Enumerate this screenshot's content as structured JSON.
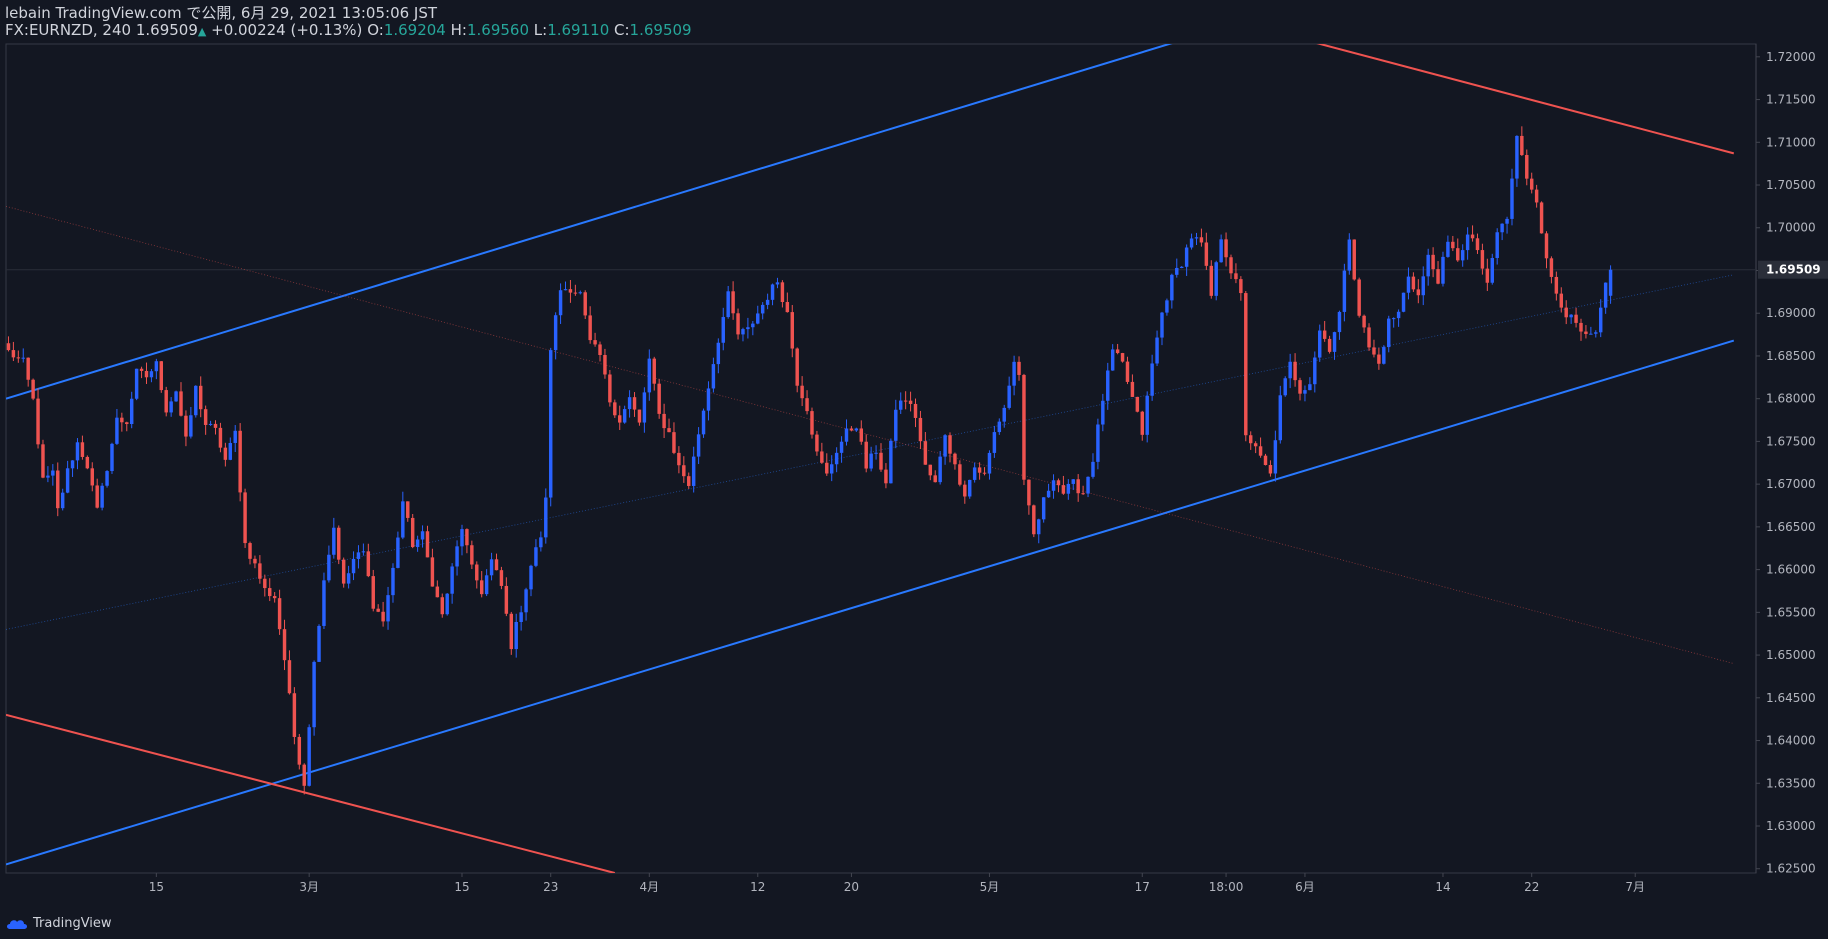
{
  "header": {
    "line1": "lebain TradingView.com で公開, 6月 29, 2021 13:05:06 JST",
    "symbol": "FX:EURNZD, 240",
    "last": "1.69509",
    "change_arrow": "▲",
    "change": "+0.00224 (+0.13%)",
    "o_label": "O:",
    "o": "1.69204",
    "h_label": "H:",
    "h": "1.69560",
    "l_label": "L:",
    "l": "1.69110",
    "c_label": "C:",
    "c": "1.69509"
  },
  "footer": {
    "brand": "TradingView",
    "icon": "tradingview-cloud-icon"
  },
  "colors": {
    "background": "#131722",
    "up": "#2962ff",
    "down": "#ef5350",
    "channel_blue": "#2979ff",
    "channel_red": "#ef5350",
    "axis_text": "#b2b5be",
    "ohlc_value": "#26a69a"
  },
  "chart_data": {
    "type": "candlestick",
    "y_ticks": [
      "1.72000",
      "1.71500",
      "1.71000",
      "1.70500",
      "1.70000",
      "1.69500",
      "1.69000",
      "1.68500",
      "1.68000",
      "1.67500",
      "1.67000",
      "1.66500",
      "1.66000",
      "1.65500",
      "1.65000",
      "1.64500",
      "1.64000",
      "1.63500",
      "1.63000",
      "1.62500"
    ],
    "ylim": [
      1.6245,
      1.7215
    ],
    "last_price_label": "1.69509",
    "x_ticks": [
      "15",
      "3月",
      "15",
      "23",
      "4月",
      "12",
      "20",
      "5月",
      "17",
      "18:00",
      "6月",
      "14",
      "22",
      "7月"
    ],
    "x_tick_index": [
      30,
      61,
      92,
      110,
      130,
      152,
      171,
      199,
      230,
      247,
      263,
      291,
      309,
      330
    ],
    "n_bars": 355,
    "close_path": [
      [
        0,
        1.6855
      ],
      [
        3,
        1.6842
      ],
      [
        5,
        1.6798
      ],
      [
        7,
        1.6703
      ],
      [
        9,
        1.6712
      ],
      [
        10,
        1.6669
      ],
      [
        12,
        1.6715
      ],
      [
        14,
        1.6748
      ],
      [
        16,
        1.6722
      ],
      [
        18,
        1.6668
      ],
      [
        20,
        1.672
      ],
      [
        22,
        1.6775
      ],
      [
        24,
        1.6773
      ],
      [
        26,
        1.683
      ],
      [
        28,
        1.6826
      ],
      [
        30,
        1.684
      ],
      [
        32,
        1.6788
      ],
      [
        34,
        1.681
      ],
      [
        36,
        1.675
      ],
      [
        38,
        1.6812
      ],
      [
        40,
        1.677
      ],
      [
        42,
        1.6762
      ],
      [
        44,
        1.6728
      ],
      [
        46,
        1.676
      ],
      [
        48,
        1.663
      ],
      [
        50,
        1.6605
      ],
      [
        52,
        1.6576
      ],
      [
        54,
        1.6568
      ],
      [
        56,
        1.6495
      ],
      [
        58,
        1.6405
      ],
      [
        60,
        1.635
      ],
      [
        62,
        1.649
      ],
      [
        64,
        1.659
      ],
      [
        66,
        1.665
      ],
      [
        68,
        1.658
      ],
      [
        70,
        1.6612
      ],
      [
        72,
        1.662
      ],
      [
        74,
        1.656
      ],
      [
        76,
        1.654
      ],
      [
        78,
        1.66
      ],
      [
        80,
        1.668
      ],
      [
        82,
        1.663
      ],
      [
        84,
        1.664
      ],
      [
        86,
        1.6586
      ],
      [
        88,
        1.6546
      ],
      [
        90,
        1.66
      ],
      [
        92,
        1.665
      ],
      [
        94,
        1.66
      ],
      [
        96,
        1.6575
      ],
      [
        98,
        1.661
      ],
      [
        100,
        1.658
      ],
      [
        102,
        1.6512
      ],
      [
        104,
        1.6555
      ],
      [
        106,
        1.6605
      ],
      [
        108,
        1.664
      ],
      [
        109,
        1.668
      ],
      [
        110,
        1.686
      ],
      [
        112,
        1.6928
      ],
      [
        114,
        1.693
      ],
      [
        116,
        1.6922
      ],
      [
        118,
        1.6865
      ],
      [
        120,
        1.685
      ],
      [
        122,
        1.6798
      ],
      [
        124,
        1.6775
      ],
      [
        126,
        1.68
      ],
      [
        128,
        1.677
      ],
      [
        130,
        1.6845
      ],
      [
        132,
        1.678
      ],
      [
        134,
        1.676
      ],
      [
        136,
        1.672
      ],
      [
        138,
        1.67
      ],
      [
        140,
        1.676
      ],
      [
        142,
        1.6815
      ],
      [
        144,
        1.687
      ],
      [
        146,
        1.692
      ],
      [
        148,
        1.6875
      ],
      [
        150,
        1.688
      ],
      [
        152,
        1.69
      ],
      [
        154,
        1.692
      ],
      [
        156,
        1.6938
      ],
      [
        158,
        1.69
      ],
      [
        160,
        1.682
      ],
      [
        162,
        1.679
      ],
      [
        164,
        1.6735
      ],
      [
        166,
        1.671
      ],
      [
        168,
        1.674
      ],
      [
        170,
        1.676
      ],
      [
        172,
        1.677
      ],
      [
        174,
        1.672
      ],
      [
        176,
        1.674
      ],
      [
        178,
        1.67
      ],
      [
        180,
        1.679
      ],
      [
        182,
        1.68
      ],
      [
        184,
        1.678
      ],
      [
        186,
        1.672
      ],
      [
        188,
        1.67
      ],
      [
        190,
        1.676
      ],
      [
        192,
        1.672
      ],
      [
        194,
        1.669
      ],
      [
        196,
        1.672
      ],
      [
        198,
        1.671
      ],
      [
        200,
        1.676
      ],
      [
        202,
        1.679
      ],
      [
        204,
        1.6842
      ],
      [
        205,
        1.683
      ],
      [
        206,
        1.67
      ],
      [
        208,
        1.664
      ],
      [
        210,
        1.668
      ],
      [
        212,
        1.671
      ],
      [
        214,
        1.669
      ],
      [
        216,
        1.67
      ],
      [
        218,
        1.669
      ],
      [
        220,
        1.673
      ],
      [
        222,
        1.68
      ],
      [
        224,
        1.6855
      ],
      [
        226,
        1.684
      ],
      [
        228,
        1.68
      ],
      [
        230,
        1.676
      ],
      [
        232,
        1.684
      ],
      [
        234,
        1.69
      ],
      [
        236,
        1.694
      ],
      [
        238,
        1.696
      ],
      [
        240,
        1.699
      ],
      [
        242,
        1.698
      ],
      [
        244,
        1.692
      ],
      [
        246,
        1.699
      ],
      [
        248,
        1.695
      ],
      [
        250,
        1.692
      ],
      [
        251,
        1.676
      ],
      [
        253,
        1.674
      ],
      [
        255,
        1.672
      ],
      [
        256,
        1.671
      ],
      [
        258,
        1.68
      ],
      [
        260,
        1.684
      ],
      [
        262,
        1.681
      ],
      [
        264,
        1.682
      ],
      [
        266,
        1.688
      ],
      [
        268,
        1.686
      ],
      [
        270,
        1.69
      ],
      [
        272,
        1.699
      ],
      [
        274,
        1.69
      ],
      [
        276,
        1.686
      ],
      [
        278,
        1.684
      ],
      [
        280,
        1.689
      ],
      [
        282,
        1.69
      ],
      [
        284,
        1.6945
      ],
      [
        286,
        1.692
      ],
      [
        288,
        1.6965
      ],
      [
        290,
        1.694
      ],
      [
        292,
        1.698
      ],
      [
        294,
        1.6965
      ],
      [
        296,
        1.699
      ],
      [
        298,
        1.6975
      ],
      [
        300,
        1.693
      ],
      [
        302,
        1.6995
      ],
      [
        304,
        1.701
      ],
      [
        306,
        1.7105
      ],
      [
        308,
        1.706
      ],
      [
        310,
        1.7035
      ],
      [
        312,
        1.696
      ],
      [
        314,
        1.6925
      ],
      [
        316,
        1.69
      ],
      [
        318,
        1.6885
      ],
      [
        320,
        1.687
      ],
      [
        322,
        1.6875
      ],
      [
        324,
        1.693
      ],
      [
        325,
        1.695
      ]
    ],
    "last_bar_ohlc": [
      1.69204,
      1.6956,
      1.6911,
      1.69509
    ],
    "trendlines": [
      {
        "name": "upper-blue",
        "color": "#2979ff",
        "from": [
          0,
          1.68
        ],
        "to": [
          240,
          1.7223
        ]
      },
      {
        "name": "lower-blue",
        "color": "#2979ff",
        "from": [
          0,
          1.6255
        ],
        "to": [
          350,
          1.6868
        ]
      },
      {
        "name": "upper-red",
        "color": "#ef5350",
        "from": [
          262,
          1.7222
        ],
        "to": [
          350,
          1.7087
        ]
      },
      {
        "name": "lower-red",
        "color": "#ef5350",
        "from": [
          0,
          1.643
        ],
        "to": [
          123,
          1.6245
        ]
      },
      {
        "name": "mid-blue-dotted",
        "color": "#2979ff",
        "from": [
          0,
          1.653
        ],
        "to": [
          350,
          1.6945
        ]
      },
      {
        "name": "mid-red-dotted",
        "color": "#ef5350",
        "from": [
          0,
          1.7025
        ],
        "to": [
          350,
          1.649
        ]
      }
    ],
    "grid": false,
    "legend": "none"
  }
}
